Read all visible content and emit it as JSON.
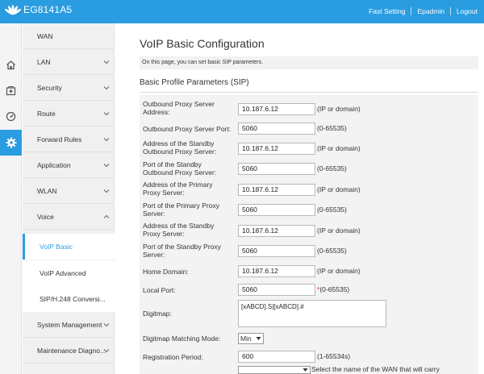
{
  "header": {
    "product": "EG8141A5",
    "links": {
      "fast_setting": "Fast Setting",
      "user": "Epadmin",
      "logout": "Logout"
    },
    "brand_color": "#2a9ce0"
  },
  "icons": [
    "home-icon",
    "plus-box-icon",
    "gauge-icon",
    "gear-icon"
  ],
  "sidebar": {
    "items": [
      {
        "label": "WAN"
      },
      {
        "label": "LAN"
      },
      {
        "label": "Security"
      },
      {
        "label": "Route"
      },
      {
        "label": "Forward Rules"
      },
      {
        "label": "Application"
      },
      {
        "label": "WLAN"
      },
      {
        "label": "Voice"
      },
      {
        "label": "System Management"
      },
      {
        "label": "Maintenance Diagno..."
      }
    ],
    "voice_sub": [
      {
        "label": "VoIP Basic",
        "active": true
      },
      {
        "label": "VoIP Advanced"
      },
      {
        "label": "SIP/H.248 Conversi..."
      }
    ]
  },
  "main": {
    "title": "VoIP Basic Configuration",
    "notice": "On this page, you can set basic SIP parameters.",
    "section": "Basic Profile Parameters (SIP)",
    "fields": {
      "outbound_proxy_server": {
        "label_l1": "Outbound Proxy Server",
        "label_l2": "Address:",
        "value": "10.187.6.12",
        "hint": "(IP or domain)"
      },
      "outbound_proxy_port": {
        "label": "Outbound Proxy Server Port:",
        "value": "5060",
        "hint": "(0-65535)"
      },
      "standby_outbound_server": {
        "label_l1": "Address of the Standby",
        "label_l2": "Outbound Proxy Server:",
        "value": "10.187.6.12",
        "hint": "(IP or domain)"
      },
      "standby_outbound_port": {
        "label_l1": "Port of the Standby",
        "label_l2": "Outbound Proxy Server:",
        "value": "5060",
        "hint": "(0-65535)"
      },
      "primary_proxy_server": {
        "label_l1": "Address of the Primary",
        "label_l2": "Proxy Server:",
        "value": "10.187.6.12",
        "hint": "(IP or domain)"
      },
      "primary_proxy_port": {
        "label_l1": "Port of the Primary Proxy",
        "label_l2": "Server:",
        "value": "5060",
        "hint": "(0-65535)"
      },
      "standby_proxy_server": {
        "label_l1": "Address of the Standby",
        "label_l2": "Proxy Server:",
        "value": "10.187.6.12",
        "hint": "(IP or domain)"
      },
      "standby_proxy_port": {
        "label_l1": "Port of the Standby Proxy",
        "label_l2": "Server:",
        "value": "5060",
        "hint": "(0-65535)"
      },
      "home_domain": {
        "label": "Home Domain:",
        "value": "10.187.6.12",
        "hint": "(IP or domain)"
      },
      "local_port": {
        "label": "Local Port:",
        "value": "5060",
        "required": "*",
        "hint": "(0-65535)"
      },
      "digitmap": {
        "label": "Digitmap:",
        "value": "[xABCD].S|[xABCD].#"
      },
      "digitmap_mode": {
        "label": "Digitmap Matching Mode:",
        "value": "Min"
      },
      "registration_period": {
        "label": "Registration Period:",
        "value": "600",
        "hint": "(1-65534s)"
      },
      "wan_select": {
        "value": "",
        "hint": "Select the name of the WAN that will carry"
      }
    }
  }
}
